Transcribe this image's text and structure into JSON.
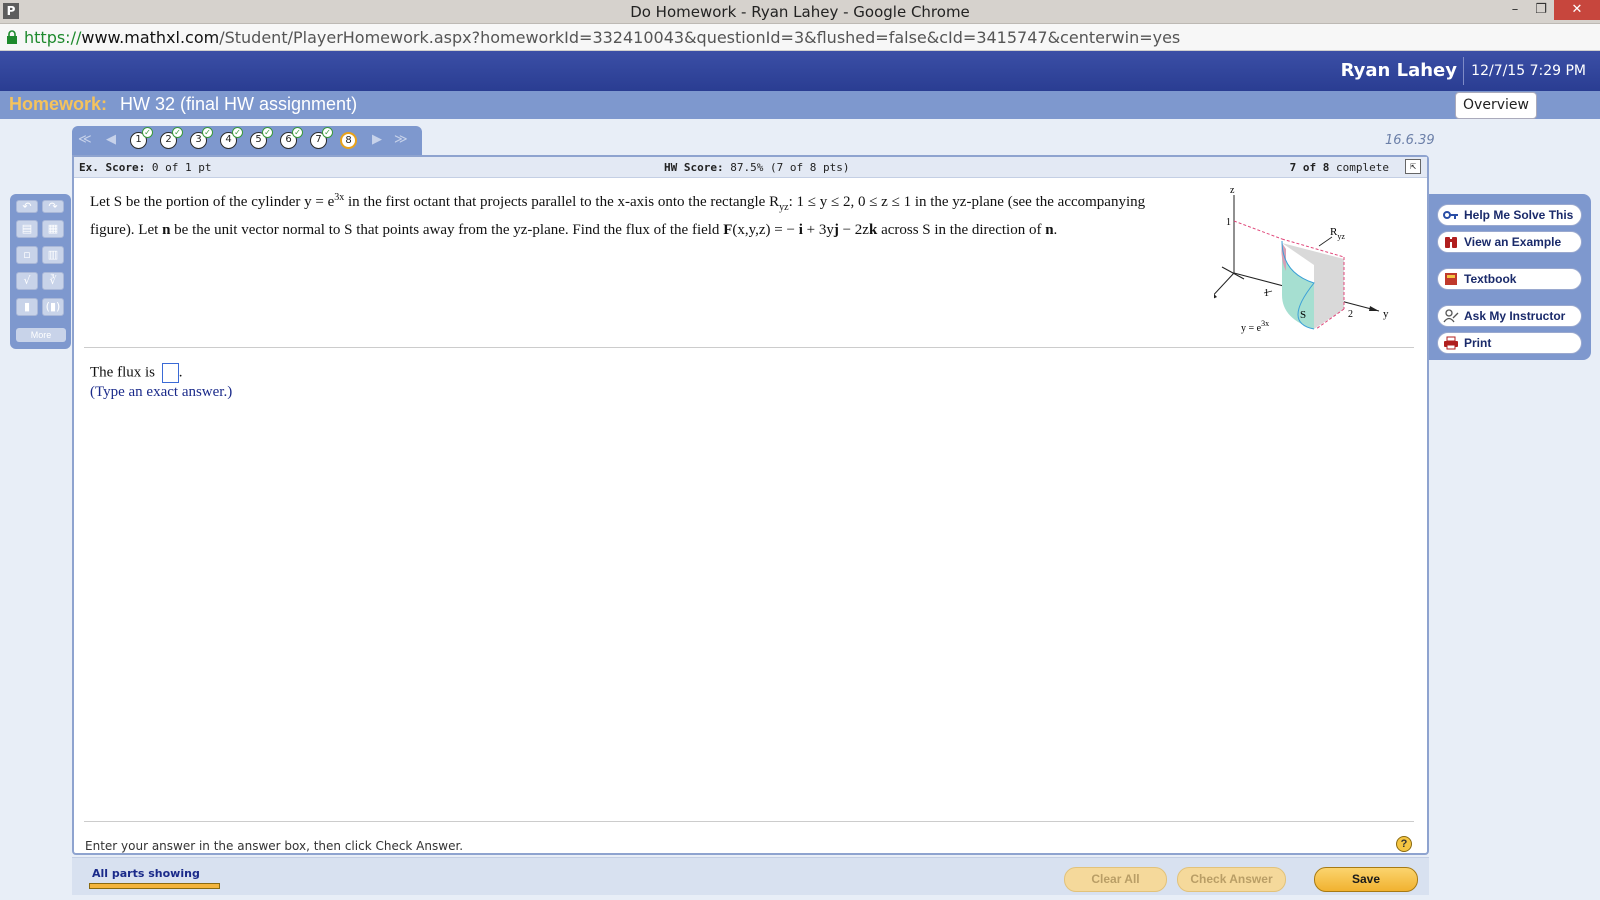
{
  "browser": {
    "app_icon": "P",
    "window_title": "Do Homework - Ryan Lahey - Google Chrome",
    "url_scheme": "https://",
    "url_host": "www.mathxl.com",
    "url_path": "/Student/PlayerHomework.aspx?homeworkId=332410043&questionId=3&flushed=false&cId=3415747&centerwin=yes",
    "window_controls": {
      "minimize": "–",
      "restore": "❐",
      "close": "✕"
    }
  },
  "header": {
    "user_name": "Ryan Lahey",
    "datetime": "12/7/15 7:29 PM"
  },
  "homework": {
    "label": "Homework:",
    "title": "HW 32 (final HW assignment)",
    "overview_label": "Overview"
  },
  "nav": {
    "first": "≪",
    "prev": "◀",
    "next": "▶",
    "last": "≫",
    "questions": [
      "1",
      "2",
      "3",
      "4",
      "5",
      "6",
      "7",
      "8"
    ],
    "check_mark": "✓",
    "question_id": "16.6.39"
  },
  "score": {
    "ex_label": "Ex. Score:",
    "ex_value": "0 of 1 pt",
    "hw_label": "HW Score:",
    "hw_value": "87.5% (7 of 8 pts)",
    "progress_count": "7 of 8",
    "progress_label": "complete"
  },
  "question": {
    "p1": "Let S be the portion of the cylinder y = e",
    "p1_sup": "3x",
    "p2": " in the first octant that projects parallel to the x-axis onto the rectangle R",
    "p2_sub": "yz",
    "p3": ": 1 ≤ y ≤ 2, 0 ≤ z ≤ 1 in the yz-plane (see the accompanying figure). Let ",
    "n_bold": "n",
    "p4": " be the unit vector normal to S that points away from the yz-plane. Find the flux of the field ",
    "F_bold": "F",
    "p5": "(x,y,z) = − ",
    "i_bold": "i",
    "p6": " + 3y",
    "j_bold": "j",
    "p7": " − 2z",
    "k_bold": "k",
    "p8": " across S in the direction of ",
    "n2_bold": "n",
    "p9": "."
  },
  "figure": {
    "z": "z",
    "x": "x",
    "y": "y",
    "one_z": "1",
    "one_y": "1",
    "two": "2",
    "R": "R",
    "R_sub": "yz",
    "S": "S",
    "curve": "y = e",
    "curve_sup": "3x"
  },
  "answer": {
    "prefix": "The flux is",
    "suffix": ".",
    "hint": "(Type an exact answer.)"
  },
  "footer": {
    "instruction": "Enter your answer in the answer box, then click Check Answer.",
    "help": "?"
  },
  "toolbar": {
    "more": "More",
    "tools": [
      "↶",
      "↷",
      "▤",
      "▦",
      "▫",
      "▥",
      "√",
      "∛",
      "▮",
      "(▮)"
    ]
  },
  "sidebar": {
    "help_me_solve": "Help Me Solve This",
    "view_example": "View an Example",
    "textbook": "Textbook",
    "ask_instructor": "Ask My Instructor",
    "print": "Print"
  },
  "bottom": {
    "parts": "All parts showing",
    "clear_all": "Clear All",
    "check_answer": "Check Answer",
    "save": "Save"
  }
}
